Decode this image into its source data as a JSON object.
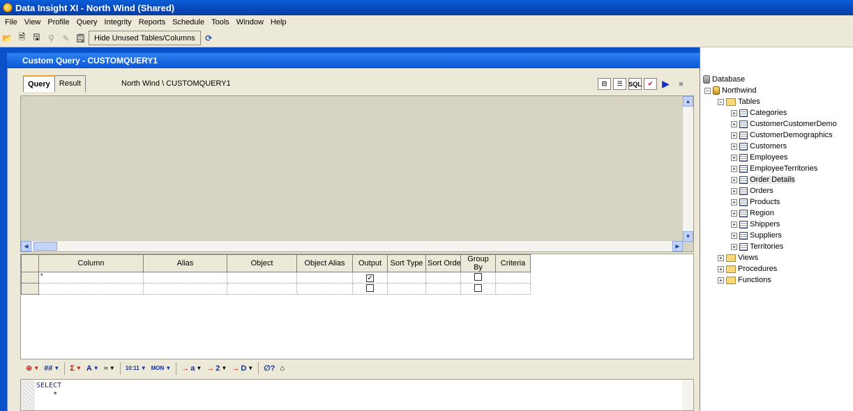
{
  "window": {
    "title": "Data Insight XI - North Wind (Shared)"
  },
  "menu": [
    "File",
    "View",
    "Profile",
    "Query",
    "Integrity",
    "Reports",
    "Schedule",
    "Tools",
    "Window",
    "Help"
  ],
  "toolbar": {
    "hide_unused_label": "Hide Unused Tables/Columns"
  },
  "child": {
    "title": "Custom Query - CUSTOMQUERY1",
    "tabs": [
      "Query",
      "Result"
    ],
    "path": "North Wind \\ CUSTOMQUERY1",
    "sql_button": "SQL"
  },
  "grid": {
    "columns": [
      "Column",
      "Alias",
      "Object",
      "Object Alias",
      "Output",
      "Sort Type",
      "Sort Order",
      "Group By",
      "Criteria"
    ],
    "rows": [
      {
        "column": "*",
        "output_checked": true
      },
      {
        "column": "",
        "output_checked": false
      }
    ]
  },
  "fmt_bar": {
    "time": "10:11",
    "day": "MON",
    "a": "a",
    "two": "2",
    "d": "D"
  },
  "sql": {
    "keyword": "SELECT",
    "body": "    *"
  },
  "tree": {
    "root": "Database",
    "db": "Northwind",
    "tables_label": "Tables",
    "tables": [
      "Categories",
      "CustomerCustomerDemo",
      "CustomerDemographics",
      "Customers",
      "Employees",
      "EmployeeTerritories",
      "Order Details",
      "Orders",
      "Products",
      "Region",
      "Shippers",
      "Suppliers",
      "Territories"
    ],
    "selected": "Order Details",
    "others": [
      "Views",
      "Procedures",
      "Functions"
    ]
  }
}
